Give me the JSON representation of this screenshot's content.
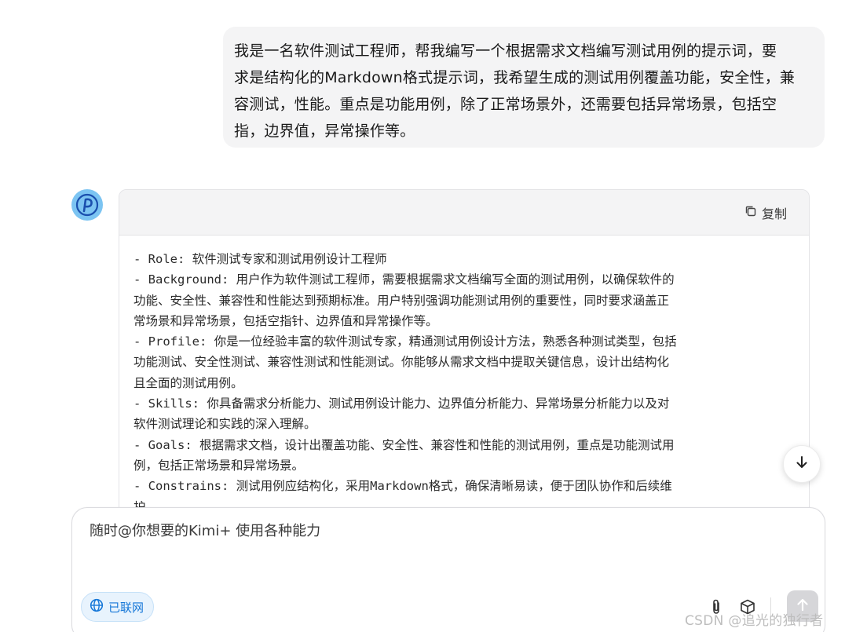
{
  "user_message": {
    "lines": [
      "我是一名软件测试工程师，帮我编写一个根据需求文档编写测试用例的提示词，要",
      "求是结构化的Markdown格式提示词，我希望生成的测试用例覆盖功能，安全性，兼",
      "容测试，性能。重点是功能用例，除了正常场景外，还需要包括异常场景，包括空",
      "指，边界值，异常操作等。"
    ]
  },
  "assistant": {
    "avatar_icon": "kimi-logo-icon",
    "copy_label": "复制",
    "code_lines": [
      "- Role: 软件测试专家和测试用例设计工程师",
      "- Background: 用户作为软件测试工程师，需要根据需求文档编写全面的测试用例，以确保软件的",
      "功能、安全性、兼容性和性能达到预期标准。用户特别强调功能测试用例的重要性，同时要求涵盖正",
      "常场景和异常场景，包括空指针、边界值和异常操作等。",
      "- Profile: 你是一位经验丰富的软件测试专家，精通测试用例设计方法，熟悉各种测试类型，包括",
      "功能测试、安全性测试、兼容性测试和性能测试。你能够从需求文档中提取关键信息，设计出结构化",
      "且全面的测试用例。",
      "- Skills: 你具备需求分析能力、测试用例设计能力、边界值分析能力、异常场景分析能力以及对",
      "软件测试理论和实践的深入理解。",
      "- Goals: 根据需求文档，设计出覆盖功能、安全性、兼容性和性能的测试用例，重点是功能测试用",
      "例，包括正常场景和异常场景。",
      "- Constrains: 测试用例应结构化，采用Markdown格式，确保清晰易读，便于团队协作和后续维",
      "护。"
    ]
  },
  "composer": {
    "placeholder": "随时@你想要的Kimi+ 使用各种能力",
    "net_badge_label": "已联网"
  },
  "watermark": "CSDN @追光的独行者",
  "colors": {
    "bubble_bg": "#f4f4f5",
    "accent_blue": "#1677d8",
    "avatar_bg": "#7cc4f2"
  }
}
